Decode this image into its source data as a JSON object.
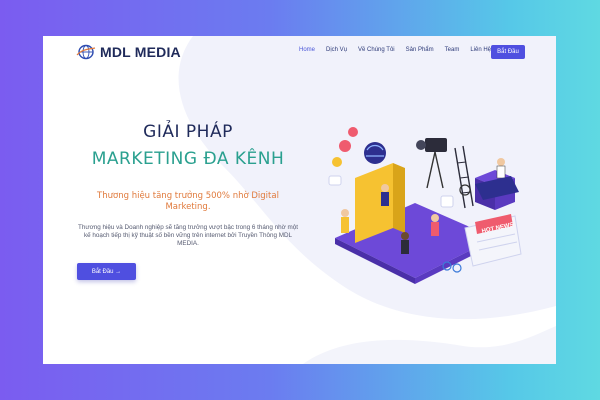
{
  "brand": {
    "name": "MDL MEDIA",
    "logo_icon": "globe-logo-icon"
  },
  "nav": {
    "items": [
      {
        "label": "Home",
        "active": true
      },
      {
        "label": "Dịch Vụ",
        "active": false
      },
      {
        "label": "Về Chúng Tôi",
        "active": false
      },
      {
        "label": "Sản Phẩm",
        "active": false
      },
      {
        "label": "Team",
        "active": false
      },
      {
        "label": "Liên Hệ",
        "active": false
      }
    ],
    "cta_label": "Bắt Đầu"
  },
  "hero": {
    "title_line1": "GIẢI PHÁP",
    "title_line2": "MARKETING ĐA KÊNH",
    "tagline": "Thương hiệu tăng trưởng 500% nhờ Digital Marketing.",
    "description": "Thương hiệu và Doanh nghiệp sẽ tăng trưởng vượt bậc trong 6 tháng nhờ một kế hoạch tiếp thị kỹ thuật số bền vững trên internet bởi Truyền Thông MDL MEDIA.",
    "cta_label": "Bắt Đầu →",
    "illustration": "digital-marketing-isometric-illustration",
    "illustration_text": "HOT NEWS"
  },
  "colors": {
    "accent": "#4f4fe0",
    "title": "#1f2a5a",
    "title_secondary": "#2aa08f",
    "tagline": "#e07a3c",
    "bg_gradient_left": "#7b5cf0",
    "bg_gradient_right": "#5fd9e2"
  }
}
